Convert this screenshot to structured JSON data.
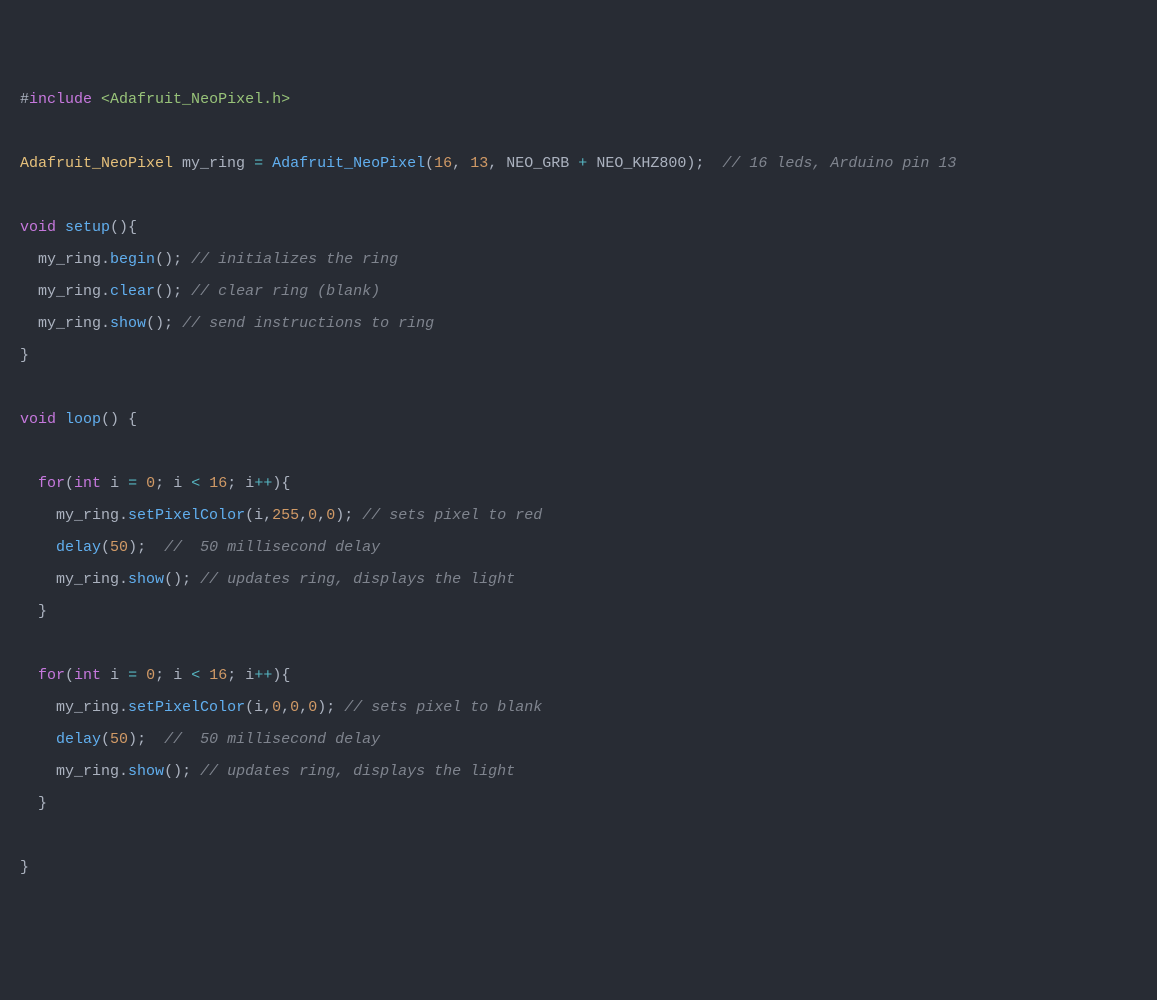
{
  "code": {
    "include_directive": "include",
    "include_header": "<Adafruit_NeoPixel.h>",
    "decl_type": "Adafruit_NeoPixel",
    "decl_var": "my_ring",
    "ctor": "Adafruit_NeoPixel",
    "ctor_arg1": "16",
    "ctor_arg2": "13",
    "ctor_neogrb": "NEO_GRB",
    "ctor_khz": "NEO_KHZ800",
    "decl_comment": "// 16 leds, Arduino pin 13",
    "void1": "void",
    "setup": "setup",
    "obj": "my_ring",
    "begin": "begin",
    "begin_comment": "// initializes the ring",
    "clear": "clear",
    "clear_comment": "// clear ring (blank)",
    "show": "show",
    "show1_comment": "// send instructions to ring",
    "void2": "void",
    "loop": "loop",
    "for_kw": "for",
    "int_kw": "int",
    "i": "i",
    "zero": "0",
    "lt": "<",
    "sixteen": "16",
    "ipp": "i++",
    "setPixelColor": "setPixelColor",
    "spc_red_args_255": "255",
    "spc_zero": "0",
    "spc_red_comment": "// sets pixel to red",
    "delay": "delay",
    "fifty": "50",
    "delay_comment": "//  50 millisecond delay",
    "show_loop_comment": "// updates ring, displays the light",
    "spc_blank_comment": "// sets pixel to blank"
  }
}
